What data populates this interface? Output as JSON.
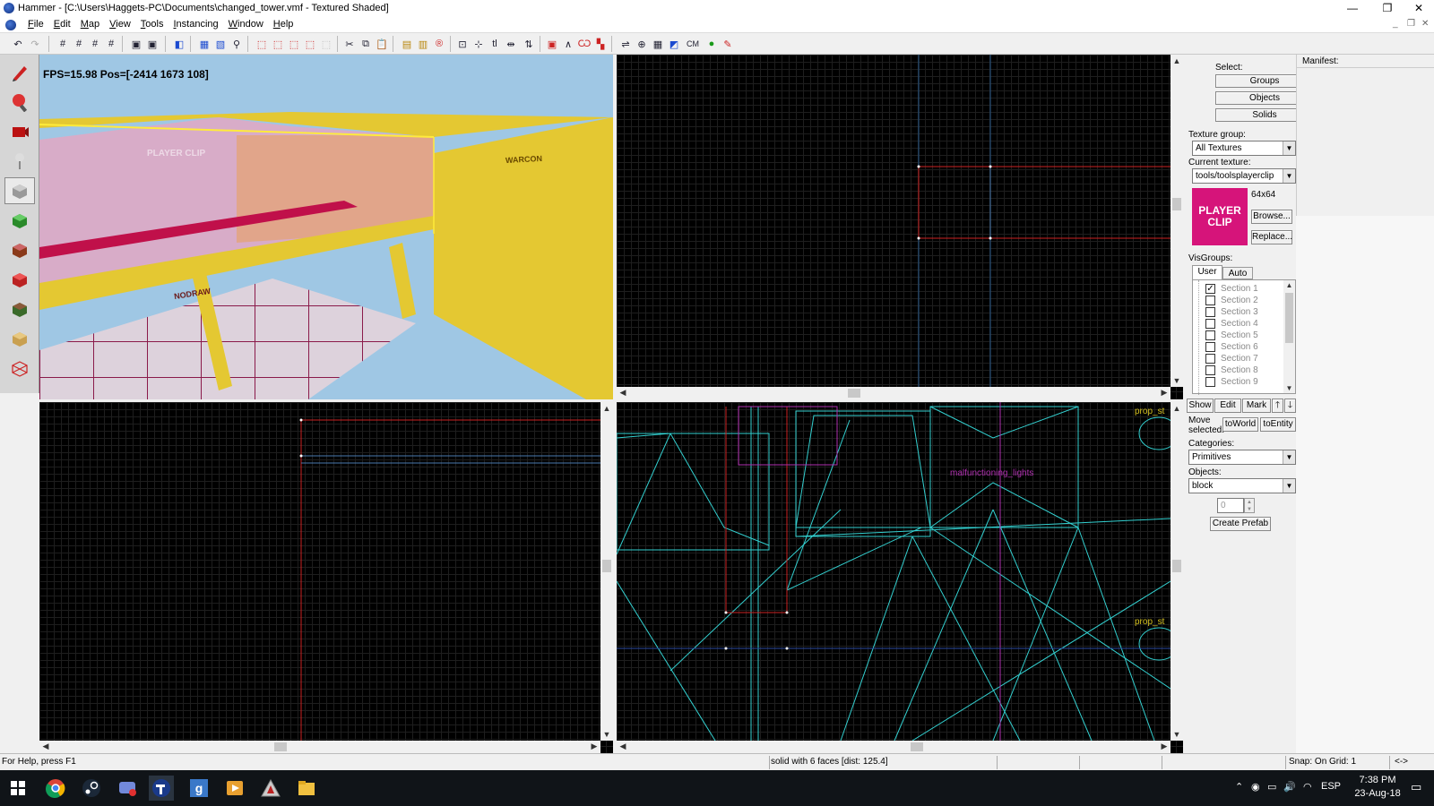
{
  "window": {
    "title": "Hammer - [C:\\Users\\Haggets-PC\\Documents\\changed_tower.vmf - Textured Shaded]",
    "controls": {
      "minimize": "—",
      "restore": "❐",
      "close": "✕"
    },
    "mdi_controls": {
      "minimize": "_",
      "restore": "❐",
      "close": "✕"
    }
  },
  "menu": [
    "File",
    "Edit",
    "Map",
    "View",
    "Tools",
    "Instancing",
    "Window",
    "Help"
  ],
  "viewport_3d": {
    "overlay": "FPS=15.98 Pos=[-2414 1673 108]",
    "texture_labels": {
      "player_clip": "PLAYER CLIP",
      "nodraw": "NODRAW",
      "warcon": "WARCON"
    }
  },
  "viewport_2d_bottom_right": {
    "entity_labels": [
      "prop_st",
      "malfunctioning_lights",
      "prop_st"
    ]
  },
  "toolbar": {
    "label_cm": "CM"
  },
  "sidebar": {
    "select_label": "Select:",
    "groups_button": "Groups",
    "objects_button": "Objects",
    "solids_button": "Solids",
    "texture_group_label": "Texture group:",
    "texture_group_value": "All Textures",
    "current_texture_label": "Current texture:",
    "current_texture_value": "tools/toolsplayerclip",
    "texture_preview_text": "PLAYER CLIP",
    "texture_size": "64x64",
    "browse_button": "Browse...",
    "replace_button": "Replace...",
    "visgroups_label": "VisGroups:",
    "visgroup_tabs": [
      "User",
      "Auto"
    ],
    "visgroups": [
      {
        "label": "Section 1",
        "checked": true
      },
      {
        "label": "Section 2",
        "checked": false
      },
      {
        "label": "Section 3",
        "checked": false
      },
      {
        "label": "Section 4",
        "checked": false
      },
      {
        "label": "Section 5",
        "checked": false
      },
      {
        "label": "Section 6",
        "checked": false
      },
      {
        "label": "Section 7",
        "checked": false
      },
      {
        "label": "Section 8",
        "checked": false
      },
      {
        "label": "Section 9",
        "checked": false
      }
    ],
    "show_button": "Show",
    "edit_button": "Edit",
    "mark_button": "Mark",
    "move_up": "🡑",
    "move_down": "🡓",
    "move_selected_label": "Move selected:",
    "to_world_button": "toWorld",
    "to_entity_button": "toEntity",
    "categories_label": "Categories:",
    "categories_value": "Primitives",
    "objects_label": "Objects:",
    "objects_value": "block",
    "faces_value": "0",
    "create_prefab_button": "Create Prefab"
  },
  "manifest": {
    "label": "Manifest:"
  },
  "statusbar": {
    "help": "For Help, press F1",
    "selection": "solid with 6 faces  [dist: 125.4]",
    "snap": "Snap: On Grid: 1",
    "arrows": "<->"
  },
  "taskbar": {
    "language": "ESP",
    "time": "7:38 PM",
    "date": "23-Aug-18"
  }
}
